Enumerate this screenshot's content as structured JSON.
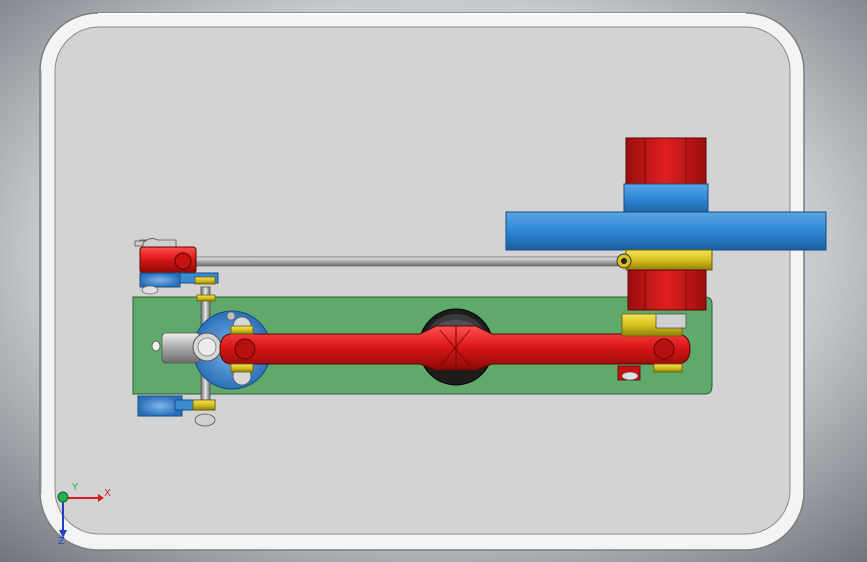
{
  "viewport": {
    "background_color": "#c9cdd2"
  },
  "colors": {
    "base_plate": "#d4d4d4",
    "base_plate_rim": "#f2f2f2",
    "base_plate_edge": "#8e8e8e",
    "mount_plate": "#5faa6a",
    "crank_rod": "#d81515",
    "red_part": "#d81515",
    "flywheel": "#2f87d4",
    "blue_part": "#3a8ad2",
    "yellow_part": "#d8c21e",
    "dark_part": "#1a1a1a",
    "steel": "#a8a8a8"
  },
  "triad": {
    "x_label": "X",
    "y_label": "Y",
    "z_label": "Z",
    "x_color": "#d82020",
    "y_color": "#22b14c",
    "z_color": "#2040c8"
  }
}
